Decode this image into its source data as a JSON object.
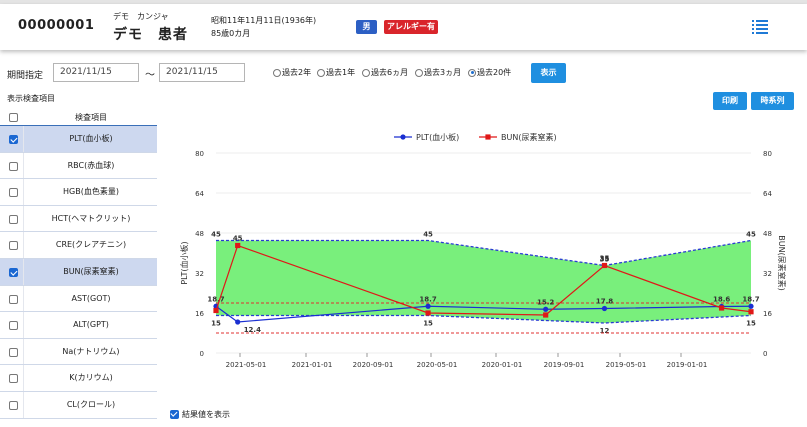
{
  "header": {
    "patient_id": "00000001",
    "kana": "デモ　カンジャ",
    "name": "デモ　患者",
    "birth": "昭和11年11月11日(1936年)",
    "age": "85歳0カ月",
    "sex_badge": "男",
    "allergy_badge": "アレルギー有",
    "menu_icon": "list-menu-icon"
  },
  "filter": {
    "period_label": "期間指定",
    "date_from": "2021/11/15",
    "date_to": "2021/11/15",
    "range_separator": "〜",
    "radios": [
      {
        "label": "過去2年",
        "checked": false
      },
      {
        "label": "過去1年",
        "checked": false
      },
      {
        "label": "過去6ヵ月",
        "checked": false
      },
      {
        "label": "過去3ヵ月",
        "checked": false
      },
      {
        "label": "過去20件",
        "checked": true
      }
    ],
    "show_button": "表示"
  },
  "actions": {
    "print_button": "印刷",
    "series_button": "時系列"
  },
  "items_panel": {
    "title": "表示検査項目",
    "header": "検査項目",
    "rows": [
      {
        "label": "PLT(血小板)",
        "checked": true
      },
      {
        "label": "RBC(赤血球)",
        "checked": false
      },
      {
        "label": "HGB(血色素量)",
        "checked": false
      },
      {
        "label": "HCT(ヘマトクリット)",
        "checked": false
      },
      {
        "label": "CRE(クレアチニン)",
        "checked": false
      },
      {
        "label": "BUN(尿素窒素)",
        "checked": true
      },
      {
        "label": "AST(GOT)",
        "checked": false
      },
      {
        "label": "ALT(GPT)",
        "checked": false
      },
      {
        "label": "Na(ナトリウム)",
        "checked": false
      },
      {
        "label": "K(カリウム)",
        "checked": false
      },
      {
        "label": "CL(クロール)",
        "checked": false
      }
    ]
  },
  "show_values_label": "結果値を表示",
  "chart_data": {
    "type": "line",
    "xlabels": [
      "2021-05-01",
      "2021-01-01",
      "2020-09-01",
      "2020-05-01",
      "2020-01-01",
      "2019-09-01",
      "2019-05-01",
      "2019-01-01"
    ],
    "ylim": [
      0,
      80
    ],
    "yticks": [
      0,
      16,
      32,
      48,
      64,
      80
    ],
    "ylabel_left": "PLT(血小板)",
    "ylabel_right": "BUN(尿素窒素)",
    "legend_position": "top-center",
    "band": {
      "color": "#79ef7c",
      "upper": [
        45,
        45,
        35,
        45
      ],
      "lower": [
        15,
        15,
        12,
        15
      ],
      "upper_labels": [
        "45",
        "45",
        "35",
        "45"
      ],
      "lower_labels": [
        "15",
        "15",
        "12",
        "15"
      ]
    },
    "ref_lines": [
      {
        "value": 20,
        "color": "#e03030"
      },
      {
        "value": 8,
        "color": "#e03030"
      }
    ],
    "series": [
      {
        "name": "PLT(血小板)",
        "color": "#1a2fd1",
        "marker": "circle",
        "x": [
          "2021-11-15",
          "2021-10-01",
          "2020-09-01",
          "2020-01-01",
          "2019-09-01",
          "2019-01-01",
          "2018-11-01"
        ],
        "y": [
          18.7,
          12.4,
          18.7,
          17.5,
          17.8,
          18.6,
          18.7
        ],
        "labels": [
          "18.7",
          "12.4",
          "18.7",
          "15.2",
          "17.8",
          "18.6",
          "18.7"
        ]
      },
      {
        "name": "BUN(尿素窒素)",
        "color": "#e01818",
        "marker": "square",
        "x": [
          "2021-11-15",
          "2021-10-01",
          "2020-09-01",
          "2020-01-01",
          "2019-09-01",
          "2019-01-01",
          "2018-11-01"
        ],
        "y": [
          17,
          43,
          16,
          15.2,
          35,
          18,
          16.5
        ],
        "labels": [
          "",
          "45",
          "",
          "",
          "35",
          "",
          ""
        ]
      }
    ]
  },
  "colors": {
    "accent": "#1f8fe0",
    "allergy": "#d9252b",
    "sex": "#2c5fc4",
    "selected_row": "#cdd8ef"
  }
}
